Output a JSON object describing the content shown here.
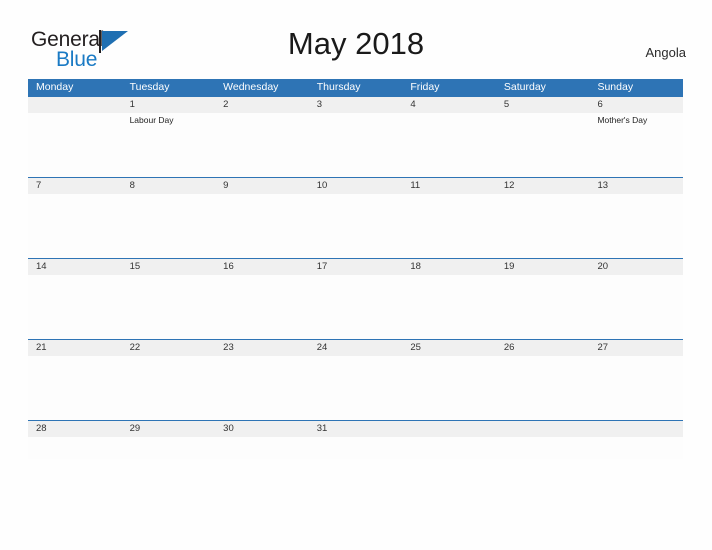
{
  "brand": {
    "name_part1": "General",
    "name_part2": "Blue",
    "flag_icon": "blue-triangle-flag-icon"
  },
  "header": {
    "title": "May 2018",
    "country": "Angola"
  },
  "calendar": {
    "month": "May",
    "year": "2018",
    "weekday_headers": [
      "Monday",
      "Tuesday",
      "Wednesday",
      "Thursday",
      "Friday",
      "Saturday",
      "Sunday"
    ],
    "weeks": [
      {
        "days": [
          {
            "date": "",
            "event": ""
          },
          {
            "date": "1",
            "event": "Labour Day"
          },
          {
            "date": "2",
            "event": ""
          },
          {
            "date": "3",
            "event": ""
          },
          {
            "date": "4",
            "event": ""
          },
          {
            "date": "5",
            "event": ""
          },
          {
            "date": "6",
            "event": "Mother's Day"
          }
        ]
      },
      {
        "days": [
          {
            "date": "7",
            "event": ""
          },
          {
            "date": "8",
            "event": ""
          },
          {
            "date": "9",
            "event": ""
          },
          {
            "date": "10",
            "event": ""
          },
          {
            "date": "11",
            "event": ""
          },
          {
            "date": "12",
            "event": ""
          },
          {
            "date": "13",
            "event": ""
          }
        ]
      },
      {
        "days": [
          {
            "date": "14",
            "event": ""
          },
          {
            "date": "15",
            "event": ""
          },
          {
            "date": "16",
            "event": ""
          },
          {
            "date": "17",
            "event": ""
          },
          {
            "date": "18",
            "event": ""
          },
          {
            "date": "19",
            "event": ""
          },
          {
            "date": "20",
            "event": ""
          }
        ]
      },
      {
        "days": [
          {
            "date": "21",
            "event": ""
          },
          {
            "date": "22",
            "event": ""
          },
          {
            "date": "23",
            "event": ""
          },
          {
            "date": "24",
            "event": ""
          },
          {
            "date": "25",
            "event": ""
          },
          {
            "date": "26",
            "event": ""
          },
          {
            "date": "27",
            "event": ""
          }
        ]
      },
      {
        "days": [
          {
            "date": "28",
            "event": ""
          },
          {
            "date": "29",
            "event": ""
          },
          {
            "date": "30",
            "event": ""
          },
          {
            "date": "31",
            "event": ""
          },
          {
            "date": "",
            "event": ""
          },
          {
            "date": "",
            "event": ""
          },
          {
            "date": "",
            "event": ""
          }
        ]
      }
    ]
  },
  "colors": {
    "header_blue": "#2e74b5",
    "brand_blue": "#1a7ac4",
    "date_band_gray": "#f0f0f0",
    "page_background": "#fefefe",
    "text_dark": "#1a1a1a"
  }
}
